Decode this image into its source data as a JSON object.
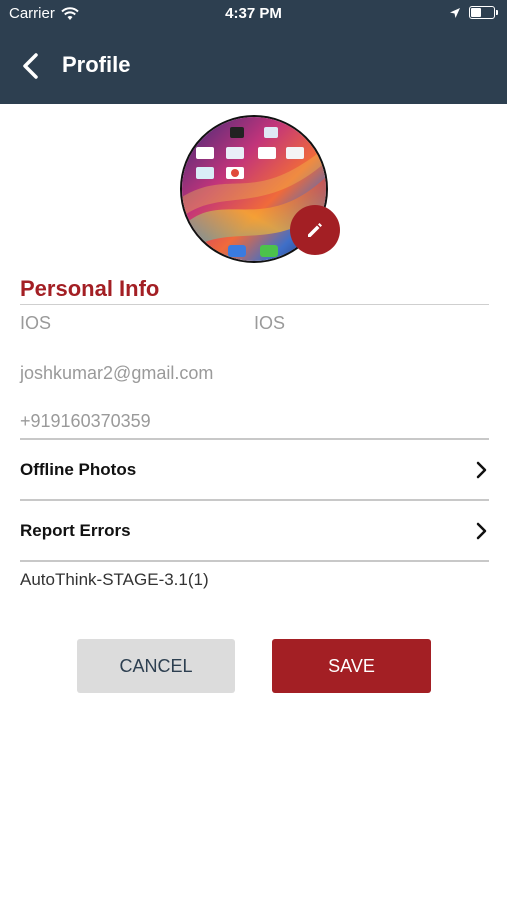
{
  "status_bar": {
    "carrier": "Carrier",
    "time": "4:37 PM"
  },
  "nav": {
    "title": "Profile",
    "background_color": "#2d3f50"
  },
  "profile": {
    "section_title": "Personal Info",
    "first_name": "IOS",
    "last_name": "IOS",
    "email": "joshkumar2@gmail.com",
    "phone": "+919160370359"
  },
  "menu": {
    "items": [
      {
        "label": "Offline Photos",
        "icon": "chevron-right-icon"
      },
      {
        "label": "Report Errors",
        "icon": "chevron-right-icon"
      }
    ]
  },
  "app_version": "AutoThink-STAGE-3.1(1)",
  "actions": {
    "cancel_label": "CANCEL",
    "save_label": "SAVE"
  },
  "colors": {
    "accent": "#a31f24",
    "nav": "#2d3f50",
    "cancel_bg": "#dcdcdc"
  }
}
